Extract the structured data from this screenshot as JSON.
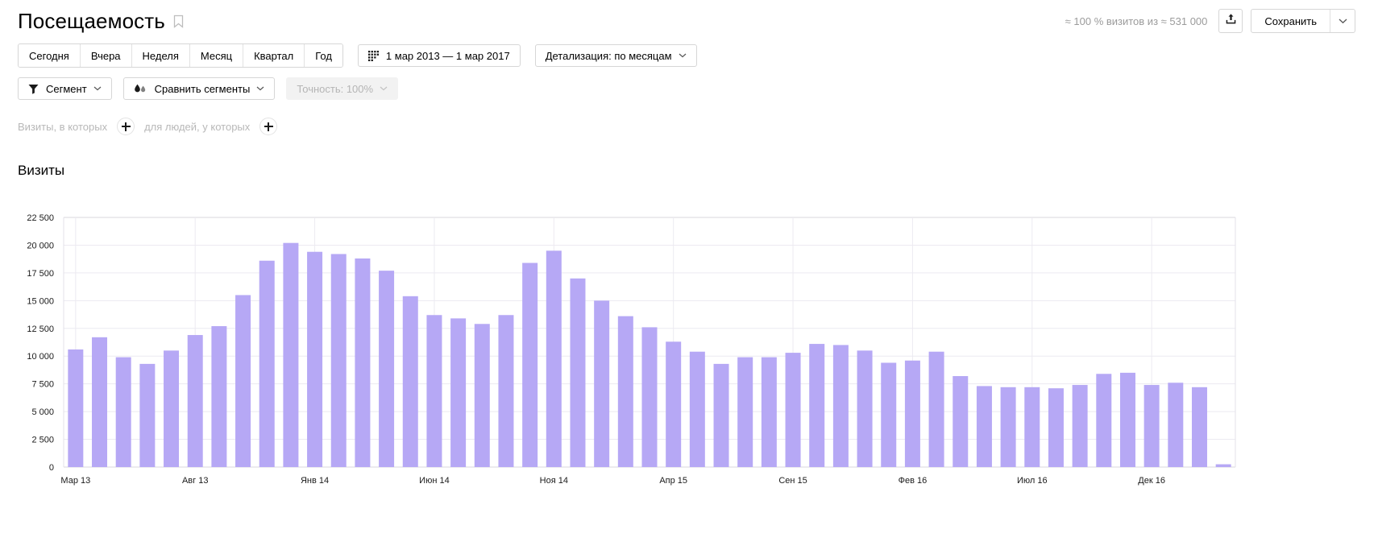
{
  "header": {
    "title": "Посещаемость",
    "bookmark_icon": "bookmark-icon",
    "visits_note": "≈ 100 % визитов из ≈ 531 000",
    "share_icon": "share-upload-icon",
    "save_label": "Сохранить",
    "save_caret_icon": "chevron-down-icon"
  },
  "toolbar": {
    "period_buttons": [
      {
        "label": "Сегодня"
      },
      {
        "label": "Вчера"
      },
      {
        "label": "Неделя"
      },
      {
        "label": "Месяц"
      },
      {
        "label": "Квартал"
      },
      {
        "label": "Год"
      }
    ],
    "date_range": {
      "icon": "calendar-grid-icon",
      "label": "1 мар 2013 — 1 мар 2017",
      "value": "1 мар 2013 — 1 мар 2017"
    },
    "detail": {
      "label": "Детализация: по месяцам",
      "caret_icon": "chevron-down-icon"
    },
    "segment": {
      "icon": "funnel-filter-icon",
      "label": "Сегмент",
      "caret_icon": "chevron-down-icon"
    },
    "compare_segments": {
      "icon": "compare-drops-icon",
      "label": "Сравнить сегменты",
      "caret_icon": "chevron-down-icon"
    },
    "accuracy": {
      "label": "Точность: 100%",
      "caret_icon": "chevron-down-icon"
    }
  },
  "filters": {
    "visits_label": "Визиты, в которых",
    "visits_add_icon": "plus-icon",
    "people_label": "для людей, у которых",
    "people_add_icon": "plus-icon"
  },
  "chart_heading": "Визиты",
  "colors": {
    "bar": "#b6a8f5",
    "grid": "#eceaf1",
    "axis_text": "#000000",
    "muted_text": "#b8b8b8"
  },
  "chart_data": {
    "type": "bar",
    "title": "Визиты",
    "xlabel": "",
    "ylabel": "",
    "ylim": [
      0,
      22500
    ],
    "yticks": [
      0,
      2500,
      5000,
      7500,
      10000,
      12500,
      15000,
      17500,
      20000,
      22500
    ],
    "ytick_labels": [
      "0",
      "2 500",
      "5 000",
      "7 500",
      "10 000",
      "12 500",
      "15 000",
      "17 500",
      "20 000",
      "22 500"
    ],
    "grid": true,
    "legend": "none",
    "xtick_labels": [
      "Мар 13",
      "Авг 13",
      "Янв 14",
      "Июн 14",
      "Ноя 14",
      "Апр 15",
      "Сен 15",
      "Фев 16",
      "Июл 16",
      "Дек 16"
    ],
    "xtick_indices": [
      0,
      5,
      10,
      15,
      20,
      25,
      30,
      35,
      40,
      45
    ],
    "categories": [
      "Мар 13",
      "Апр 13",
      "Май 13",
      "Июн 13",
      "Июл 13",
      "Авг 13",
      "Сен 13",
      "Окт 13",
      "Ноя 13",
      "Дек 13",
      "Янв 14",
      "Фев 14",
      "Мар 14",
      "Апр 14",
      "Май 14",
      "Июн 14",
      "Июл 14",
      "Авг 14",
      "Сен 14",
      "Окт 14",
      "Ноя 14",
      "Дек 14",
      "Янв 15",
      "Фев 15",
      "Мар 15",
      "Апр 15",
      "Май 15",
      "Июн 15",
      "Июл 15",
      "Авг 15",
      "Сен 15",
      "Окт 15",
      "Ноя 15",
      "Дек 15",
      "Янв 16",
      "Фев 16",
      "Мар 16",
      "Апр 16",
      "Май 16",
      "Июн 16",
      "Июл 16",
      "Авг 16",
      "Сен 16",
      "Окт 16",
      "Ноя 16",
      "Дек 16",
      "Янв 17",
      "Фев 17",
      "Мар 17"
    ],
    "values": [
      10600,
      11700,
      9900,
      9300,
      10500,
      11900,
      12700,
      15500,
      18600,
      20200,
      19400,
      19200,
      18800,
      17700,
      15400,
      13700,
      13400,
      12900,
      13700,
      18400,
      19500,
      17000,
      15000,
      13600,
      12600,
      11300,
      10400,
      9300,
      9900,
      9900,
      10300,
      11100,
      11000,
      10500,
      9400,
      9600,
      10400,
      8200,
      7300,
      7200,
      7200,
      7100,
      7400,
      8400,
      8500,
      7400,
      7600,
      7200,
      250
    ],
    "series": [
      {
        "name": "Визиты",
        "color": "#b6a8f5",
        "values": [
          10600,
          11700,
          9900,
          9300,
          10500,
          11900,
          12700,
          15500,
          18600,
          20200,
          19400,
          19200,
          18800,
          17700,
          15400,
          13700,
          13400,
          12900,
          13700,
          18400,
          19500,
          17000,
          15000,
          13600,
          12600,
          11300,
          10400,
          9300,
          9900,
          9900,
          10300,
          11100,
          11000,
          10500,
          9400,
          9600,
          10400,
          8200,
          7300,
          7200,
          7200,
          7100,
          7400,
          8400,
          8500,
          7400,
          7600,
          7200,
          250
        ]
      }
    ]
  }
}
